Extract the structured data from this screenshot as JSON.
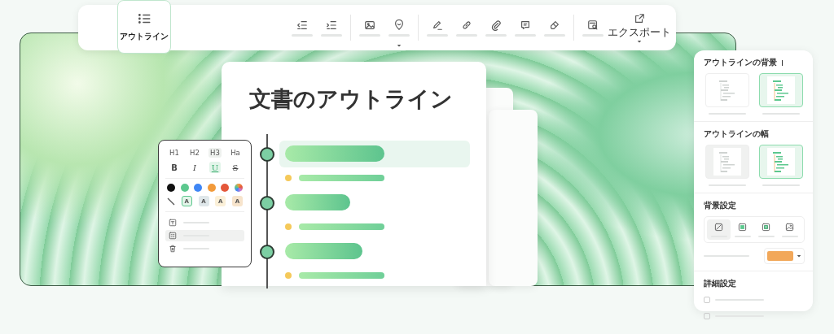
{
  "toolbar": {
    "tab": {
      "label": "アウトライン",
      "selected": true
    },
    "tool_groups": [
      [
        {
          "kind": "outdent"
        },
        {
          "kind": "indent"
        }
      ],
      [
        {
          "kind": "image"
        },
        {
          "kind": "pin",
          "dropdown": true
        }
      ],
      [
        {
          "kind": "pen"
        },
        {
          "kind": "link"
        },
        {
          "kind": "paperclip"
        },
        {
          "kind": "comment"
        },
        {
          "kind": "eraser"
        }
      ],
      [
        {
          "kind": "search-document"
        }
      ]
    ],
    "export": {
      "label": "エクスポート",
      "dropdown": true
    }
  },
  "document": {
    "title": "文書のアウトライン",
    "items": [
      {
        "kind": "heading",
        "selected": true
      },
      {
        "kind": "paragraph",
        "selected": false
      },
      {
        "kind": "heading",
        "selected": false
      },
      {
        "kind": "paragraph",
        "selected": false
      },
      {
        "kind": "heading",
        "selected": false
      },
      {
        "kind": "paragraph",
        "selected": false
      }
    ]
  },
  "format_popup": {
    "headings": [
      {
        "label": "H1",
        "selected": false
      },
      {
        "label": "H2",
        "selected": false
      },
      {
        "label": "H3",
        "selected": true
      },
      {
        "label": "Ha",
        "selected": false
      }
    ],
    "styles": [
      {
        "label": "B",
        "kind": "bold",
        "selected": false
      },
      {
        "label": "I",
        "kind": "italic",
        "selected": false
      },
      {
        "label": "U",
        "kind": "underline",
        "selected": true
      },
      {
        "label": "S",
        "kind": "strike",
        "selected": false
      }
    ],
    "colors": [
      {
        "kind": "solid",
        "color": "#111111"
      },
      {
        "kind": "solid",
        "color": "#5cc88e"
      },
      {
        "kind": "solid",
        "color": "#3f86f5"
      },
      {
        "kind": "solid",
        "color": "#f29a3a"
      },
      {
        "kind": "solid",
        "color": "#e4573a"
      },
      {
        "kind": "palette"
      }
    ],
    "highlights": [
      {
        "kind": "none",
        "selected": false
      },
      {
        "kind": "letter",
        "label": "A",
        "color": "#e4f5ea",
        "selected": true
      },
      {
        "kind": "letter",
        "label": "A",
        "color": "#dfe7ea",
        "selected": false
      },
      {
        "kind": "letter",
        "label": "A",
        "color": "#fbf0d8",
        "selected": false
      },
      {
        "kind": "letter",
        "label": "A",
        "color": "#f7e4cc",
        "selected": false
      }
    ],
    "menu": [
      {
        "kind": "insert",
        "selected": false
      },
      {
        "kind": "layout",
        "selected": true
      },
      {
        "kind": "delete",
        "selected": false
      }
    ]
  },
  "settings_panel": {
    "sections": [
      {
        "kind": "background",
        "title": "アウトラインの背景",
        "cursor": true,
        "options": [
          {
            "selected": false
          },
          {
            "selected": true
          }
        ]
      },
      {
        "kind": "width",
        "title": "アウトラインの幅",
        "options": [
          {
            "selected": false
          },
          {
            "selected": true
          }
        ]
      },
      {
        "kind": "fill",
        "title": "背景設定",
        "options": [
          {
            "kind": "none",
            "selected": true
          },
          {
            "kind": "solid",
            "selected": false
          },
          {
            "kind": "pattern",
            "selected": false
          },
          {
            "kind": "image",
            "selected": false
          }
        ],
        "swatch": {
          "color": "#f2a85a",
          "dropdown": true
        }
      },
      {
        "kind": "advanced",
        "title": "詳細設定",
        "checkboxes": [
          {
            "checked": false
          },
          {
            "checked": false
          }
        ]
      }
    ]
  }
}
